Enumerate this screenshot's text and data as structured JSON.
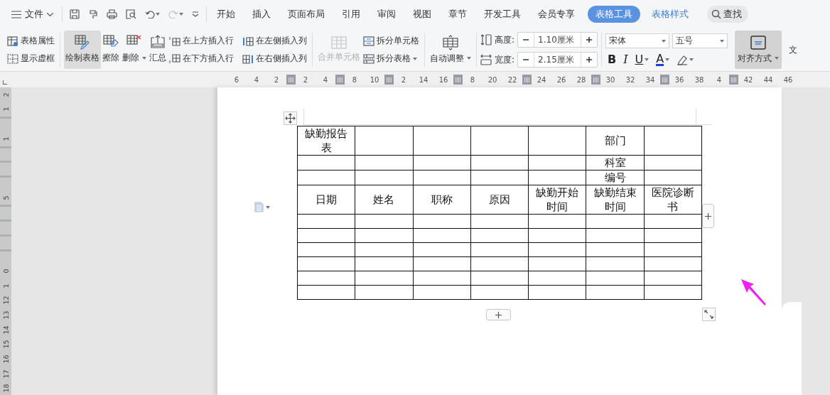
{
  "menu_bar": {
    "file_menu": "文件",
    "quick_access": [
      {
        "kind": "save",
        "disabled": false
      },
      {
        "kind": "painter",
        "disabled": false
      },
      {
        "kind": "print",
        "disabled": false
      },
      {
        "kind": "preview",
        "disabled": false
      },
      {
        "kind": "undo",
        "disabled": false
      },
      {
        "kind": "redo",
        "disabled": true
      },
      {
        "kind": "more",
        "disabled": false
      }
    ],
    "tabs": [
      {
        "label": "开始",
        "kind": "main",
        "selected": false
      },
      {
        "label": "插入",
        "kind": "main",
        "selected": false
      },
      {
        "label": "页面布局",
        "kind": "main",
        "selected": false
      },
      {
        "label": "引用",
        "kind": "main",
        "selected": false
      },
      {
        "label": "审阅",
        "kind": "main",
        "selected": false
      },
      {
        "label": "视图",
        "kind": "main",
        "selected": false
      },
      {
        "label": "章节",
        "kind": "main",
        "selected": false
      },
      {
        "label": "开发工具",
        "kind": "main",
        "selected": false
      },
      {
        "label": "会员专享",
        "kind": "main",
        "selected": false
      },
      {
        "label": "表格工具",
        "kind": "context",
        "selected": true
      },
      {
        "label": "表格样式",
        "kind": "context",
        "selected": false
      }
    ],
    "search": "查找"
  },
  "ribbon": {
    "table_options": [
      {
        "kind": "properties",
        "label": "表格属性"
      },
      {
        "kind": "gridlines",
        "label": "显示虚框"
      }
    ],
    "tools": [
      {
        "kind": "draw",
        "label": "绘制表格",
        "selected": true,
        "dropdown": false
      },
      {
        "kind": "erase",
        "label": "擦除",
        "selected": false,
        "dropdown": false
      },
      {
        "kind": "delete",
        "label": "删除",
        "selected": false,
        "dropdown": true
      },
      {
        "kind": "sum",
        "label": "汇总",
        "selected": false,
        "dropdown": false
      }
    ],
    "insert": [
      {
        "kind": "row-above",
        "label": "在上方插入行"
      },
      {
        "kind": "row-below",
        "label": "在下方插入行"
      },
      {
        "kind": "col-left",
        "label": "在左侧插入列"
      },
      {
        "kind": "col-right",
        "label": "在右侧插入列"
      }
    ],
    "merge": {
      "label": "合并单元格",
      "disabled": true
    },
    "split": [
      {
        "kind": "cells",
        "label": "拆分单元格",
        "dropdown": false
      },
      {
        "kind": "table",
        "label": "拆分表格",
        "dropdown": true
      }
    ],
    "autofit": {
      "label": "自动调整",
      "dropdown": true
    },
    "size": [
      {
        "kind": "height",
        "label": "高度:",
        "value": "1.10厘米"
      },
      {
        "kind": "width",
        "label": "宽度:",
        "value": "2.15厘米"
      }
    ],
    "font": {
      "name": "宋体",
      "size": "五号"
    },
    "format": [
      {
        "kind": "bold",
        "text": "B",
        "dropdown": false
      },
      {
        "kind": "italic",
        "text": "I",
        "dropdown": false
      },
      {
        "kind": "underline",
        "text": "U",
        "dropdown": true
      },
      {
        "kind": "font-color",
        "text": "A",
        "dropdown": true
      },
      {
        "kind": "highlight",
        "dropdown": true
      }
    ],
    "align": {
      "label": "对齐方式",
      "selected": true,
      "dropdown": true
    },
    "cut_label": "文"
  },
  "ruler": [
    {
      "kind": "num",
      "text": "6"
    },
    {
      "kind": "num",
      "text": "4"
    },
    {
      "kind": "num",
      "text": "2"
    },
    {
      "kind": "marker"
    },
    {
      "kind": "num",
      "text": "2"
    },
    {
      "kind": "num",
      "text": "4"
    },
    {
      "kind": "marker"
    },
    {
      "kind": "num",
      "text": "8"
    },
    {
      "kind": "num",
      "text": "10"
    },
    {
      "kind": "marker"
    },
    {
      "kind": "num",
      "text": "2"
    },
    {
      "kind": "num",
      "text": "14"
    },
    {
      "kind": "num",
      "text": "16"
    },
    {
      "kind": "marker"
    },
    {
      "kind": "num",
      "text": "8"
    },
    {
      "kind": "num",
      "text": "20"
    },
    {
      "kind": "num",
      "text": "22"
    },
    {
      "kind": "marker"
    },
    {
      "kind": "num",
      "text": "24"
    },
    {
      "kind": "num",
      "text": "26"
    },
    {
      "kind": "num",
      "text": "28"
    },
    {
      "kind": "marker"
    },
    {
      "kind": "num",
      "text": "30"
    },
    {
      "kind": "num",
      "text": "32"
    },
    {
      "kind": "num",
      "text": "34"
    },
    {
      "kind": "marker"
    },
    {
      "kind": "num",
      "text": "36"
    },
    {
      "kind": "num",
      "text": "38"
    },
    {
      "kind": "num",
      "text": "4"
    },
    {
      "kind": "marker"
    },
    {
      "kind": "num",
      "text": "42"
    },
    {
      "kind": "num",
      "text": "44"
    },
    {
      "kind": "num",
      "text": "46"
    }
  ],
  "vertical_ruler": [
    {
      "kind": "num",
      "text": "2"
    },
    {
      "kind": "num",
      "text": "1"
    },
    {
      "kind": "blank"
    },
    {
      "kind": "num",
      "text": "1"
    },
    {
      "kind": "blank"
    },
    {
      "kind": "blank"
    },
    {
      "kind": "blank"
    },
    {
      "kind": "num",
      "text": "5"
    },
    {
      "kind": "blank"
    },
    {
      "kind": "blank"
    },
    {
      "kind": "blank"
    },
    {
      "kind": "blank"
    },
    {
      "kind": "num",
      "text": "0"
    },
    {
      "kind": "num",
      "text": "1"
    },
    {
      "kind": "num",
      "text": "12"
    },
    {
      "kind": "num",
      "text": "13"
    },
    {
      "kind": "num",
      "text": "14"
    },
    {
      "kind": "num",
      "text": "15"
    },
    {
      "kind": "num",
      "text": "16"
    },
    {
      "kind": "num",
      "text": "17"
    },
    {
      "kind": "num",
      "text": "18"
    }
  ],
  "table": {
    "rows": [
      {
        "kind": "tall",
        "cells": [
          "缺勤报告表",
          null,
          null,
          null,
          null,
          "部门",
          null
        ]
      },
      {
        "kind": "short",
        "cells": [
          null,
          null,
          null,
          null,
          null,
          "科室",
          null
        ]
      },
      {
        "kind": "short",
        "cells": [
          null,
          null,
          null,
          null,
          null,
          "编号",
          null
        ]
      },
      {
        "kind": "tall",
        "cells": [
          "日期",
          "姓名",
          "职称",
          "原因",
          "缺勤开始时间",
          "缺勤结束时间",
          "医院诊断书"
        ]
      },
      {
        "kind": "short",
        "cells": [
          null,
          null,
          null,
          null,
          null,
          null,
          null
        ]
      },
      {
        "kind": "short",
        "cells": [
          null,
          null,
          null,
          null,
          null,
          null,
          null
        ]
      },
      {
        "kind": "short",
        "cells": [
          null,
          null,
          null,
          null,
          null,
          null,
          null
        ]
      },
      {
        "kind": "short",
        "cells": [
          null,
          null,
          null,
          null,
          null,
          null,
          null
        ]
      },
      {
        "kind": "short",
        "cells": [
          null,
          null,
          null,
          null,
          null,
          null,
          null
        ]
      },
      {
        "kind": "short",
        "cells": [
          null,
          null,
          null,
          null,
          null,
          null,
          null
        ]
      }
    ]
  }
}
